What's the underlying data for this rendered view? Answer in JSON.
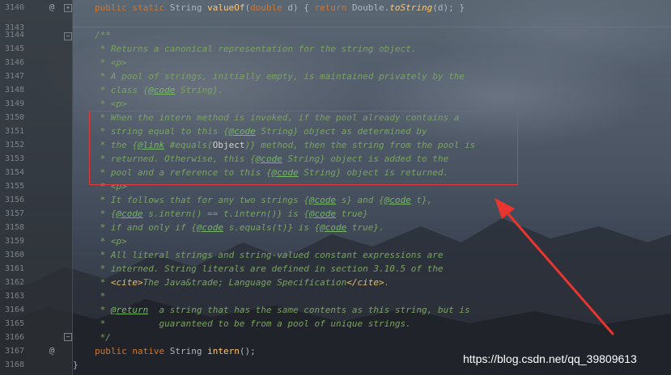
{
  "editor": {
    "lines": [
      {
        "num": "3140"
      },
      {
        "num": "3143"
      },
      {
        "num": "3144"
      },
      {
        "num": "3145"
      },
      {
        "num": "3146"
      },
      {
        "num": "3147"
      },
      {
        "num": "3148"
      },
      {
        "num": "3149"
      },
      {
        "num": "3150"
      },
      {
        "num": "3151"
      },
      {
        "num": "3152"
      },
      {
        "num": "3153"
      },
      {
        "num": "3154"
      },
      {
        "num": "3155"
      },
      {
        "num": "3156"
      },
      {
        "num": "3157"
      },
      {
        "num": "3158"
      },
      {
        "num": "3159"
      },
      {
        "num": "3160"
      },
      {
        "num": "3161"
      },
      {
        "num": "3162"
      },
      {
        "num": "3163"
      },
      {
        "num": "3164"
      },
      {
        "num": "3165"
      },
      {
        "num": "3166"
      },
      {
        "num": "3167"
      },
      {
        "num": "3168"
      }
    ],
    "code": {
      "l3140": {
        "kw1": "public static ",
        "type": "String ",
        "fn": "valueOf",
        "args_open": "(",
        "kw2": "double",
        "args_rest": " d) { ",
        "kw3": "return",
        "tail1": " Double.",
        "fn2": "toString",
        "tail2": "(d); }"
      },
      "l3144": "/**",
      "l3145": " * Returns a canonical representation for the string object.",
      "l3146": " * <p>",
      "l3147": " * A pool of strings, initially empty, is maintained privately by the",
      "l3148": {
        "pre": " * class {",
        "tag": "@code",
        "post": " String}."
      },
      "l3149": " * <p>",
      "l3150": " * When the intern method is invoked, if the pool already contains a",
      "l3151": {
        "pre": " * string equal to this {",
        "tag": "@code",
        "post": " String} object as determined by"
      },
      "l3152": {
        "pre": " * the {",
        "tag": "@link",
        "mid": " #equals(",
        "obj": "Object",
        "post": ")} method, then the string from the pool is"
      },
      "l3153": {
        "pre": " * returned. Otherwise, this {",
        "tag": "@code",
        "post": " String} object is added to the"
      },
      "l3154": {
        "pre": " * pool and a reference to this {",
        "tag": "@code",
        "post": " String} object is returned."
      },
      "l3155": " * <p>",
      "l3156": {
        "pre": " * It follows that for any two strings {",
        "tag": "@code",
        "mid": " s} and {",
        "tag2": "@code",
        "post": " t},"
      },
      "l3157": {
        "pre": " * {",
        "tag": "@code",
        "mid": " s.intern() == t.intern()} is {",
        "tag2": "@code",
        "post": " true}"
      },
      "l3158": {
        "pre": " * if and only if {",
        "tag": "@code",
        "mid": " s.equals(t)} is {",
        "tag2": "@code",
        "post": " true}."
      },
      "l3159": " * <p>",
      "l3160": " * All literal strings and string-valued constant expressions are",
      "l3161": " * interned. String literals are defined in section 3.10.5 of the",
      "l3162": {
        "pre": " * ",
        "cite_open": "<cite>",
        "text": "The Java&trade; Language Specification",
        "cite_close": "</cite>",
        "post": "."
      },
      "l3163": " *",
      "l3164": {
        "pre": " * ",
        "tag": "@return",
        "post": "  a string that has the same contents as this string, but is"
      },
      "l3165": " *          guaranteed to be from a pool of unique strings.",
      "l3166": " */",
      "l3167": {
        "kw": "public native ",
        "type": "String ",
        "fn": "intern",
        "post": "();"
      },
      "l3168": "}"
    },
    "gutter_icons": {
      "override_icon_3140": "@",
      "override_icon_3167": "@",
      "fold_plus": "+",
      "fold_minus": "−"
    }
  },
  "watermark": "https://blog.csdn.net/qq_39809613",
  "colors": {
    "annotation_box": "#e03a3a",
    "arrow": "#e8352f",
    "method_separator": "#7b5cbf",
    "doc_comment": "#7aa361",
    "keyword": "#cc7832",
    "function": "#ffc66d"
  }
}
